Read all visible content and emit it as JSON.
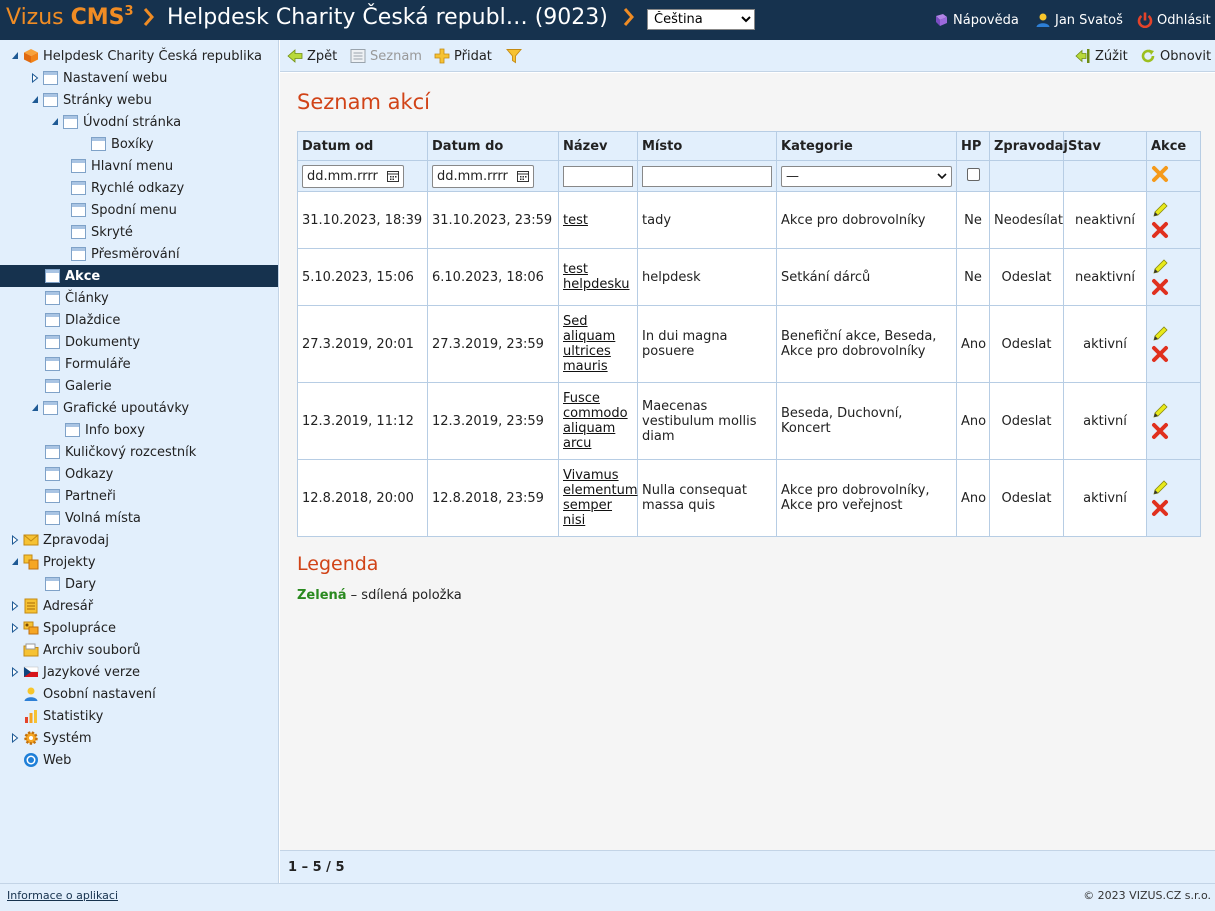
{
  "header": {
    "logo_brand": "Vizus",
    "logo_cms": "CMS",
    "logo_sup": "3",
    "site_title": "Helpdesk Charity Česká republ… (9023)",
    "language": "Čeština",
    "help": "Nápověda",
    "user": "Jan Svatoš",
    "logout": "Odhlásit"
  },
  "sidebar": {
    "items": [
      {
        "label": "Helpdesk Charity Česká republika"
      },
      {
        "label": "Nastavení webu"
      },
      {
        "label": "Stránky webu"
      },
      {
        "label": "Úvodní stránka"
      },
      {
        "label": "Boxíky"
      },
      {
        "label": "Hlavní menu"
      },
      {
        "label": "Rychlé odkazy"
      },
      {
        "label": "Spodní menu"
      },
      {
        "label": "Skryté"
      },
      {
        "label": "Přesměrování"
      },
      {
        "label": "Akce"
      },
      {
        "label": "Články"
      },
      {
        "label": "Dlaždice"
      },
      {
        "label": "Dokumenty"
      },
      {
        "label": "Formuláře"
      },
      {
        "label": "Galerie"
      },
      {
        "label": "Grafické upoutávky"
      },
      {
        "label": "Info boxy"
      },
      {
        "label": "Kuličkový rozcestník"
      },
      {
        "label": "Odkazy"
      },
      {
        "label": "Partneři"
      },
      {
        "label": "Volná místa"
      },
      {
        "label": "Zpravodaj"
      },
      {
        "label": "Projekty"
      },
      {
        "label": "Dary"
      },
      {
        "label": "Adresář"
      },
      {
        "label": "Spolupráce"
      },
      {
        "label": "Archiv souborů"
      },
      {
        "label": "Jazykové verze"
      },
      {
        "label": "Osobní nastavení"
      },
      {
        "label": "Statistiky"
      },
      {
        "label": "Systém"
      },
      {
        "label": "Web"
      }
    ]
  },
  "toolbar": {
    "back": "Zpět",
    "list": "Seznam",
    "add": "Přidat",
    "narrow": "Zúžit",
    "refresh": "Obnovit"
  },
  "page": {
    "title": "Seznam akcí"
  },
  "table": {
    "columns": [
      "Datum od",
      "Datum do",
      "Název",
      "Místo",
      "Kategorie",
      "HP",
      "Zpravodaj",
      "Stav",
      "Akce"
    ],
    "filters": {
      "date_placeholder": "dd.mm.rrrr",
      "category_selected": "—"
    },
    "rows": [
      {
        "from": "31.10.2023, 18:39",
        "to": "31.10.2023, 23:59",
        "name": "test",
        "place": "tady",
        "category": "Akce pro dobrovolníky",
        "hp": "Ne",
        "newsletter": "Neodesílat",
        "status": "neaktivní"
      },
      {
        "from": "5.10.2023, 15:06",
        "to": "6.10.2023, 18:06",
        "name": "test helpdesku",
        "place": "helpdesk",
        "category": "Setkání dárců",
        "hp": "Ne",
        "newsletter": "Odeslat",
        "status": "neaktivní"
      },
      {
        "from": "27.3.2019, 20:01",
        "to": "27.3.2019, 23:59",
        "name": "Sed aliquam ultrices mauris",
        "place": "In dui magna posuere",
        "category": "Benefiční akce, Beseda, Akce pro dobrovolníky",
        "hp": "Ano",
        "newsletter": "Odeslat",
        "status": "aktivní"
      },
      {
        "from": "12.3.2019, 11:12",
        "to": "12.3.2019, 23:59",
        "name": "Fusce commodo aliquam arcu",
        "place": "Maecenas vestibulum mollis diam",
        "category": "Beseda, Duchovní, Koncert",
        "hp": "Ano",
        "newsletter": "Odeslat",
        "status": "aktivní"
      },
      {
        "from": "12.8.2018, 20:00",
        "to": "12.8.2018, 23:59",
        "name": "Vivamus elementum semper nisi",
        "place": "Nulla consequat massa quis",
        "category": "Akce pro dobrovolníky, Akce pro veřejnost",
        "hp": "Ano",
        "newsletter": "Odeslat",
        "status": "aktivní"
      }
    ]
  },
  "legend": {
    "title": "Legenda",
    "green_label": "Zelená",
    "green_text": " – sdílená položka"
  },
  "pager": {
    "text": "1 – 5 / 5"
  },
  "footer": {
    "app_info": "Informace o aplikaci",
    "copyright": "© 2023 VIZUS.CZ s.r.o."
  },
  "colors": {
    "header_bg": "#16324e",
    "accent_orange": "#f08c24",
    "title_red": "#d14317",
    "panel_blue": "#e2effc",
    "legend_green": "#2a8a1f"
  }
}
